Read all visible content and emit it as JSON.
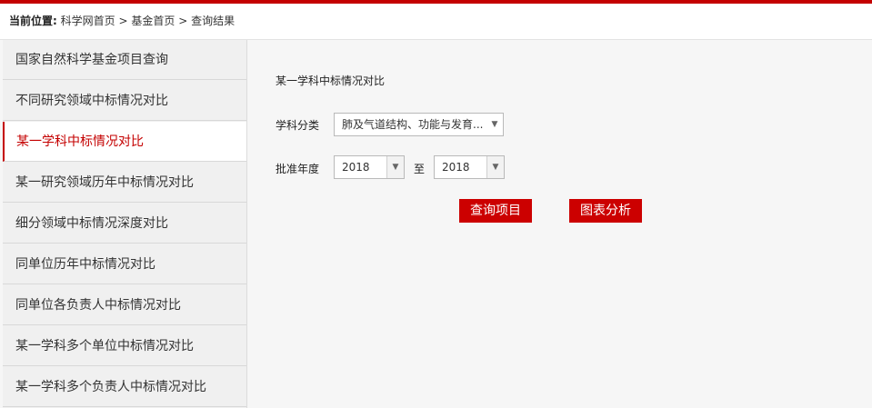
{
  "breadcrumb": {
    "label": "当前位置:",
    "home": "科学网首页",
    "sep1": ">",
    "fund": "基金首页",
    "sep2": ">",
    "current": "查询结果"
  },
  "sidebar": {
    "items": [
      {
        "label": "国家自然科学基金项目查询"
      },
      {
        "label": "不同研究领域中标情况对比"
      },
      {
        "label": "某一学科中标情况对比"
      },
      {
        "label": "某一研究领域历年中标情况对比"
      },
      {
        "label": "细分领域中标情况深度对比"
      },
      {
        "label": "同单位历年中标情况对比"
      },
      {
        "label": "同单位各负责人中标情况对比"
      },
      {
        "label": "某一学科多个单位中标情况对比"
      },
      {
        "label": "某一学科多个负责人中标情况对比"
      }
    ],
    "active_index": 2
  },
  "panel": {
    "title": "某一学科中标情况对比",
    "subject_label": "学科分类",
    "subject_value": "肺及气道结构、功能与发育...",
    "year_label": "批准年度",
    "year_from": "2018",
    "year_to_label": "至",
    "year_to": "2018",
    "query_button": "查询项目",
    "chart_button": "图表分析"
  },
  "colors": {
    "accent": "#c40000",
    "button": "#cc0000"
  }
}
